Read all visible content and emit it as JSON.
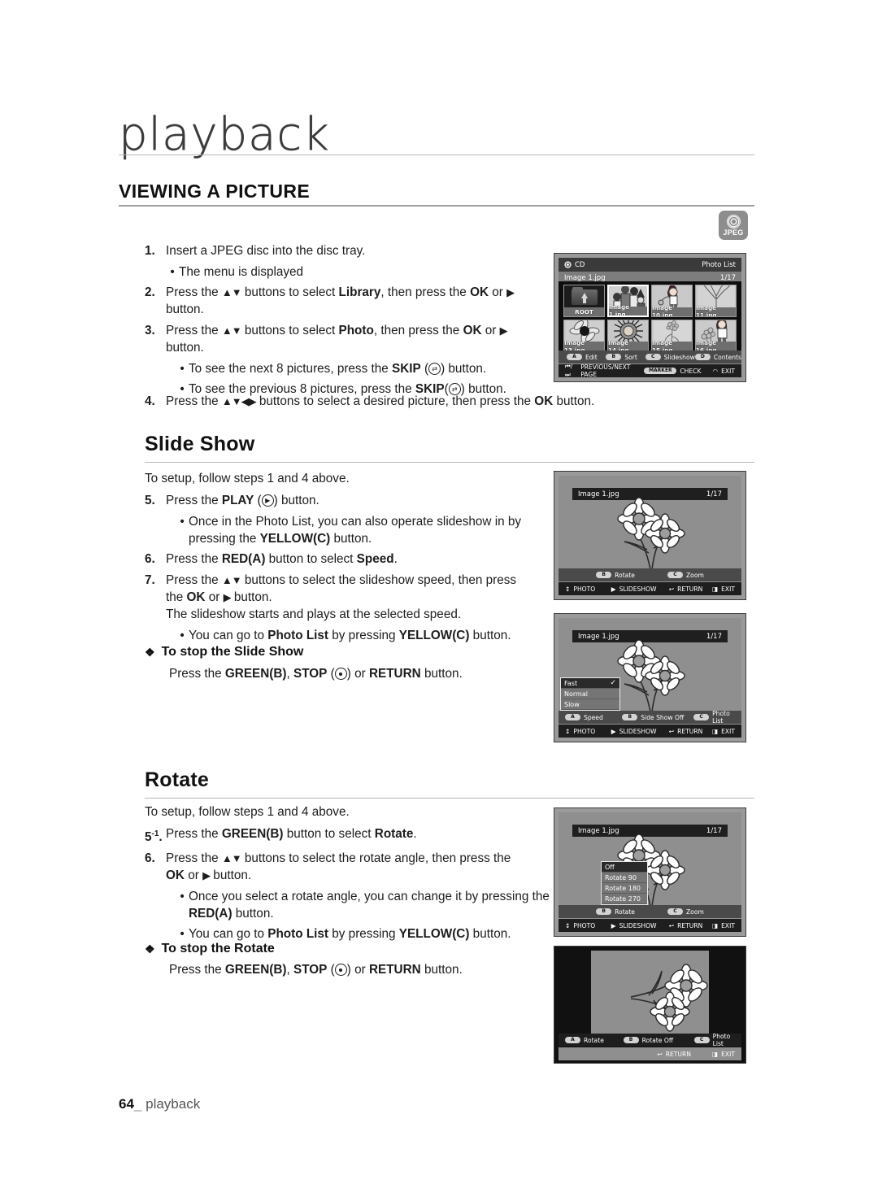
{
  "page": {
    "chapter": "playback",
    "section_title": "VIEWING A PICTURE",
    "footer_number": "64",
    "footer_underscore": "_",
    "footer_label": "playback",
    "badge_label": "JPEG"
  },
  "steps_main": {
    "s1_num": "1.",
    "s1_text": "Insert a JPEG disc into the disc tray.",
    "s1_b1": "The menu is displayed",
    "s2_num": "2.",
    "s2_a": "Press the ",
    "s2_arrows": "▲▼",
    "s2_b": " buttons to select ",
    "s2_bold1": "Library",
    "s2_c": ", then press the ",
    "s2_bold2": "OK",
    "s2_d": " or ",
    "s2_arrow2": "▶",
    "s2_e": "button.",
    "s3_num": "3.",
    "s3_a": "Press the ",
    "s3_arrows": "▲▼",
    "s3_b": " buttons to select ",
    "s3_bold1": "Photo",
    "s3_c": ", then press the ",
    "s3_bold2": "OK",
    "s3_d": " or ",
    "s3_arrow2": "▶",
    "s3_e": "button.",
    "s3_b1_a": "To see the next 8 pictures, press the ",
    "s3_b1_bold": "SKIP",
    "s3_b1_b": ") button.",
    "s3_b2_a": "To see the previous 8 pictures, press the ",
    "s3_b2_bold": "SKIP",
    "s3_b2_b": ") button.",
    "s4_num": "4.",
    "s4_a": "Press the ",
    "s4_arrows": "▲▼◀▶",
    "s4_b": " buttons to select a desired picture, then press the ",
    "s4_bold": "OK",
    "s4_c": " button."
  },
  "slideshow": {
    "heading": "Slide Show",
    "intro": "To setup, follow steps 1 and 4 above.",
    "s5_num": "5.",
    "s5_a": "Press the ",
    "s5_bold": "PLAY",
    "s5_b": " (",
    "s5_c": ") button.",
    "s5_b1_a": "Once in the Photo List, you can also operate slideshow in by",
    "s5_b1_b": "pressing the ",
    "s5_b1_bold": "YELLOW(C)",
    "s5_b1_c": " button.",
    "s6_num": "6.",
    "s6_a": "Press the ",
    "s6_bold1": "RED(A)",
    "s6_b": " button to select ",
    "s6_bold2": "Speed",
    "s6_c": ".",
    "s7_num": "7.",
    "s7_a": "Press the ",
    "s7_arrows": "▲▼",
    "s7_b": " buttons to select the slideshow speed, then press",
    "s7_c": "the ",
    "s7_bold": "OK",
    "s7_d": " or ",
    "s7_arrow": "▶",
    "s7_e": " button.",
    "s7_line3": "The slideshow starts and plays at the selected speed.",
    "s7_b1_a": "You can go to ",
    "s7_b1_bold1": "Photo List",
    "s7_b1_b": " by pressing ",
    "s7_b1_bold2": "YELLOW(C)",
    "s7_b1_c": " button.",
    "stop_heading": "To stop the Slide Show",
    "stop_a": "Press the ",
    "stop_bold1": "GREEN(B)",
    "stop_b": ", ",
    "stop_bold2": "STOP",
    "stop_c": " (",
    "stop_d": ") or ",
    "stop_bold3": "RETURN",
    "stop_e": " button."
  },
  "rotate": {
    "heading": "Rotate",
    "intro": "To setup, follow steps 1 and 4 above.",
    "s5_num": "5",
    "s5_sup": "-1",
    "s5_dot": ".",
    "s5_a": "Press the ",
    "s5_bold1": "GREEN(B)",
    "s5_b": " button to select ",
    "s5_bold2": "Rotate",
    "s5_c": ".",
    "s6_num": "6.",
    "s6_a": "Press the ",
    "s6_arrows": "▲▼",
    "s6_b": " buttons to select the rotate angle, then press the",
    "s6_c": "OK",
    "s6_d": " or ",
    "s6_arrow": "▶",
    "s6_e": " button.",
    "s6_b1_a": "Once you select a rotate angle, you can change it by pressing the",
    "s6_b1_bold": "RED(A)",
    "s6_b1_b": " button.",
    "s6_b2_a": "You can go to ",
    "s6_b2_bold1": "Photo List",
    "s6_b2_b": " by pressing ",
    "s6_b2_bold2": "YELLOW(C)",
    "s6_b2_c": " button.",
    "stop_heading": "To stop the Rotate",
    "stop_a": "Press the ",
    "stop_bold1": "GREEN(B)",
    "stop_b": ", ",
    "stop_bold2": "STOP",
    "stop_c": " (",
    "stop_d": ") or ",
    "stop_bold3": "RETURN",
    "stop_e": " button."
  },
  "tv_photolist": {
    "disc_label": "CD",
    "screen_title": "Photo List",
    "file_name": "Image 1.jpg",
    "counter": "1/17",
    "thumbs": [
      {
        "label": "ROOT",
        "kind": "folder"
      },
      {
        "label": "Image 1.jpg",
        "kind": "people"
      },
      {
        "label": "Image 10.jpg",
        "kind": "girl"
      },
      {
        "label": "Image 11.jpg",
        "kind": "tree"
      },
      {
        "label": "Image 13.jpg",
        "kind": "darkflower"
      },
      {
        "label": "Image 14.jpg",
        "kind": "sun"
      },
      {
        "label": "Image 15.jpg",
        "kind": "smallflower"
      },
      {
        "label": "Image 16.jpg",
        "kind": "girl2"
      }
    ],
    "keys": [
      {
        "btn": "A",
        "label": "Edit"
      },
      {
        "btn": "B",
        "label": "Sort"
      },
      {
        "btn": "C",
        "label": "Slideshow"
      },
      {
        "btn": "D",
        "label": "Contents"
      }
    ],
    "nav_prevnext": "PREVIOUS/NEXT PAGE",
    "nav_prevnext_icon": "⏮/⏭",
    "marker_btn": "MARKER",
    "marker_label": "CHECK",
    "exit_label": "EXIT"
  },
  "tv_slideshow": {
    "file_name": "Image 1.jpg",
    "counter": "1/17",
    "keys": [
      {
        "btn": "B",
        "label": "Rotate"
      },
      {
        "btn": "C",
        "label": "Zoom"
      }
    ],
    "nav": [
      {
        "icon": "↕",
        "label": "PHOTO"
      },
      {
        "icon": "▶",
        "label": "SLIDESHOW"
      },
      {
        "icon": "↩",
        "label": "RETURN"
      },
      {
        "icon": "◨",
        "label": "EXIT"
      }
    ]
  },
  "tv_speed": {
    "file_name": "Image 1.jpg",
    "counter": "1/17",
    "menu": [
      {
        "label": "Fast",
        "selected": true,
        "check": "✓"
      },
      {
        "label": "Normal",
        "selected": false
      },
      {
        "label": "Slow",
        "selected": false
      }
    ],
    "keys": [
      {
        "btn": "A",
        "label": "Speed"
      },
      {
        "btn": "B",
        "label": "Side Show Off"
      },
      {
        "btn": "C",
        "label": "Photo List"
      }
    ],
    "nav": [
      {
        "icon": "↕",
        "label": "PHOTO"
      },
      {
        "icon": "▶",
        "label": "SLIDESHOW"
      },
      {
        "icon": "↩",
        "label": "RETURN"
      },
      {
        "icon": "◨",
        "label": "EXIT"
      }
    ]
  },
  "tv_rotatemenu": {
    "file_name": "Image 1.jpg",
    "counter": "1/17",
    "menu": [
      {
        "label": "Off",
        "selected": true
      },
      {
        "label": "Rotate 90",
        "selected": false
      },
      {
        "label": "Rotate 180",
        "selected": false
      },
      {
        "label": "Rotate 270",
        "selected": false
      }
    ],
    "keys": [
      {
        "btn": "B",
        "label": "Rotate"
      },
      {
        "btn": "C",
        "label": "Zoom"
      }
    ],
    "nav": [
      {
        "icon": "↕",
        "label": "PHOTO"
      },
      {
        "icon": "▶",
        "label": "SLIDESHOW"
      },
      {
        "icon": "↩",
        "label": "RETURN"
      },
      {
        "icon": "◨",
        "label": "EXIT"
      }
    ]
  },
  "tv_rotated": {
    "keys": [
      {
        "btn": "A",
        "label": "Rotate"
      },
      {
        "btn": "B",
        "label": "Rotate Off"
      },
      {
        "btn": "C",
        "label": "Photo List"
      }
    ],
    "nav": [
      {
        "icon": "↩",
        "label": "RETURN"
      },
      {
        "icon": "◨",
        "label": "EXIT"
      }
    ]
  }
}
